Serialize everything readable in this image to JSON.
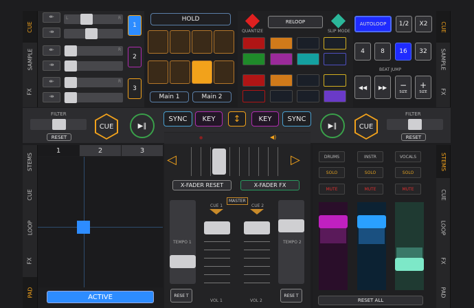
{
  "left_tabs": [
    {
      "label": "CUE",
      "active": true
    },
    {
      "label": "SAMPLE",
      "active": false
    },
    {
      "label": "FX",
      "active": false
    }
  ],
  "right_tabs": [
    {
      "label": "CUE",
      "active": true
    },
    {
      "label": "SAMPLE",
      "active": false
    },
    {
      "label": "FX",
      "active": false
    }
  ],
  "mixer_rows": [
    {
      "l": "L",
      "r": "R"
    },
    {
      "l": "L",
      "r": "R"
    },
    {
      "l": "L",
      "r": "R"
    }
  ],
  "deck_buttons": [
    {
      "label": "1",
      "active": true
    },
    {
      "label": "2",
      "active": false
    },
    {
      "label": "3",
      "active": false
    }
  ],
  "hold": {
    "label": "HOLD"
  },
  "main_buttons": [
    "Main 1",
    "Main 2"
  ],
  "quantize": {
    "label": "QUANTIZE",
    "icon": "diamond-red-icon"
  },
  "reloop": {
    "label": "RELOOP"
  },
  "slip": {
    "label": "SLIP MODE",
    "icon": "diamond-teal-icon"
  },
  "autoloop": {
    "label": "AUTOLOOP"
  },
  "loop_sizes_top": [
    "1/2",
    "X2"
  ],
  "loop_sizes": [
    "4",
    "8",
    "16",
    "32"
  ],
  "active_loop_size": "16",
  "beat_jump": {
    "label": "BEAT JUMP",
    "buttons": [
      {
        "symbol": "◀◀",
        "label": ""
      },
      {
        "symbol": "▶▶",
        "label": ""
      },
      {
        "symbol": "−",
        "label": "SIZE"
      },
      {
        "symbol": "+",
        "label": "SIZE"
      }
    ]
  },
  "transport": {
    "filter_label": "FILTER",
    "reset_label": "RESET",
    "cue_label": "CUE",
    "play_symbol": "▶‖",
    "sync_label": "SYNC",
    "key_label": "KEY",
    "up_icon": "arrow-up-icon"
  },
  "colors": {
    "accent": "#f2a21b",
    "play": "#3aa14a",
    "active_blue": "#1f5bff",
    "key": "#b02cb0",
    "stem_drums": "#c020c0",
    "stem_instr": "#2aa0ff",
    "stem_vocals": "#7de8c8"
  },
  "lower_left_tabs": [
    "STEMS",
    "CUE",
    "LOOP",
    "FX",
    "PAD"
  ],
  "active_lower_left_tab": "PAD",
  "pad_tabs": [
    "1",
    "2",
    "3"
  ],
  "active_pad_tab": "1",
  "active_label": "ACTIVE",
  "mixer": {
    "xfader_reset": "X-FADER RESET",
    "xfader_fx": "X-FADER FX",
    "master": "MASTER",
    "cue1": "CUE 1",
    "cue2": "CUE 2",
    "tempo1": "TEMPO 1",
    "tempo2": "TEMPO 2",
    "vol1": "VOL 1",
    "vol2": "VOL 2",
    "reset_short": "RESE T"
  },
  "stems": {
    "columns": [
      {
        "name": "DRUMS",
        "solo": "SOLO",
        "mute": "MUTE"
      },
      {
        "name": "INSTR",
        "solo": "SOLO",
        "mute": "MUTE"
      },
      {
        "name": "VOCALS",
        "solo": "SOLO",
        "mute": "MUTE"
      }
    ],
    "reset_all": "RESET ALL"
  },
  "lower_right_tabs": [
    "STEMS",
    "CUE",
    "LOOP",
    "FX",
    "PAD"
  ],
  "active_lower_right_tab": "STEMS"
}
